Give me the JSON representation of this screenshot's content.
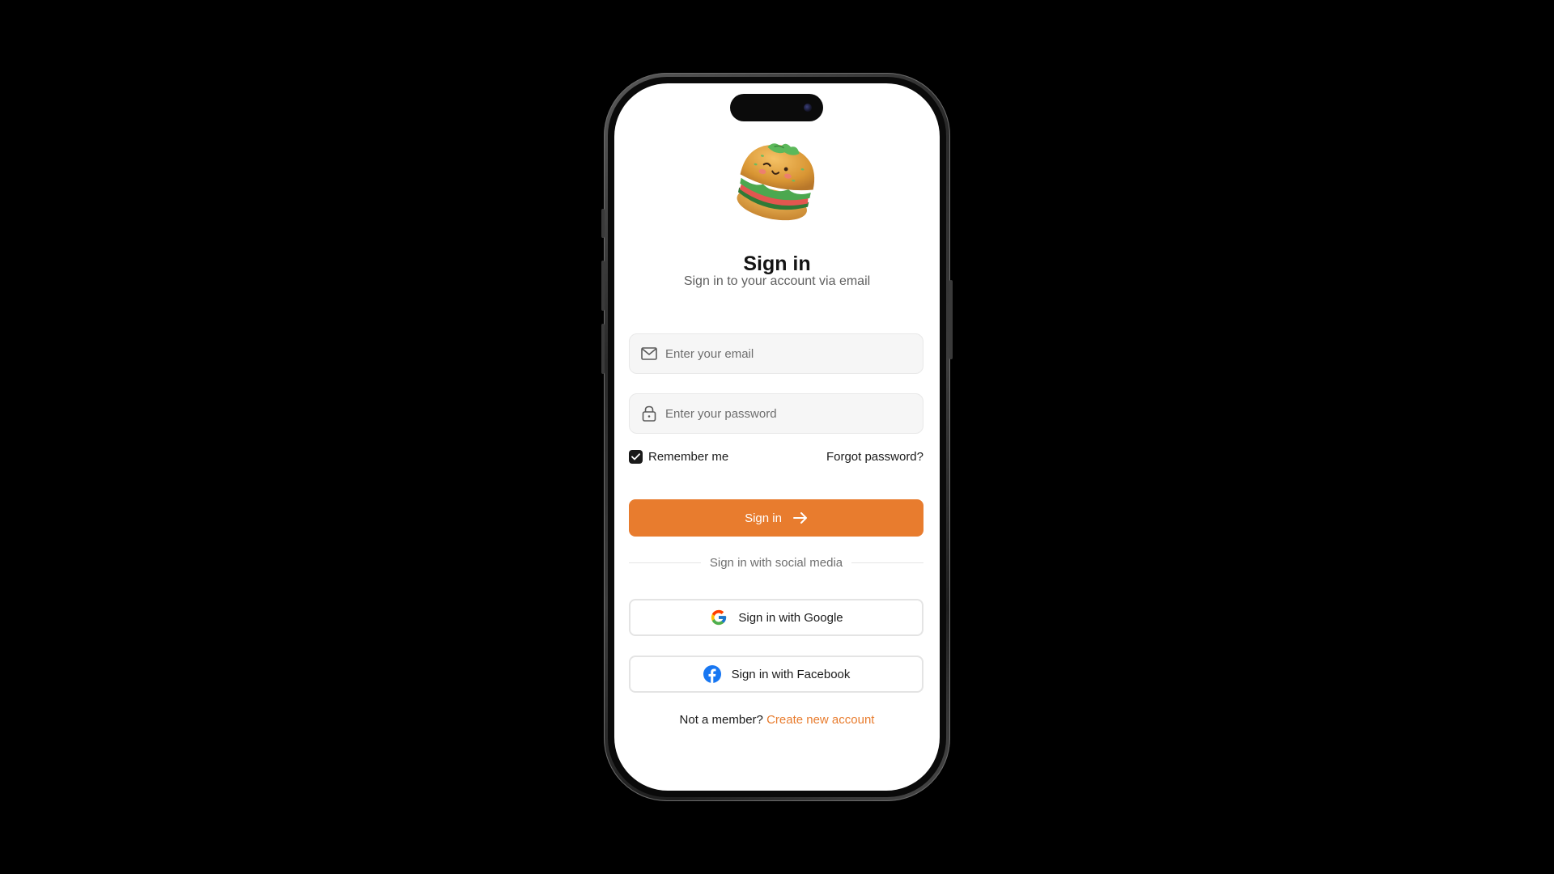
{
  "auth": {
    "title": "Sign in",
    "subtitle": "Sign in to your account via email",
    "email": {
      "placeholder": "Enter your email",
      "value": "",
      "icon": "mail-icon"
    },
    "password": {
      "placeholder": "Enter your password",
      "value": "",
      "icon": "lock-icon"
    },
    "remember_me": {
      "label": "Remember me",
      "checked": true
    },
    "forgot_password_label": "Forgot password?",
    "submit_label": "Sign in",
    "submit_icon": "arrow-right-icon",
    "divider_text": "Sign in with social media",
    "social": {
      "google_label": "Sign in with Google",
      "facebook_label": "Sign in with Facebook"
    },
    "footer": {
      "prompt": "Not a member?",
      "link": "Create new account"
    }
  },
  "colors": {
    "accent": "#e87c2e",
    "background": "#000000",
    "screen": "#ffffff",
    "facebook": "#1877f2"
  }
}
